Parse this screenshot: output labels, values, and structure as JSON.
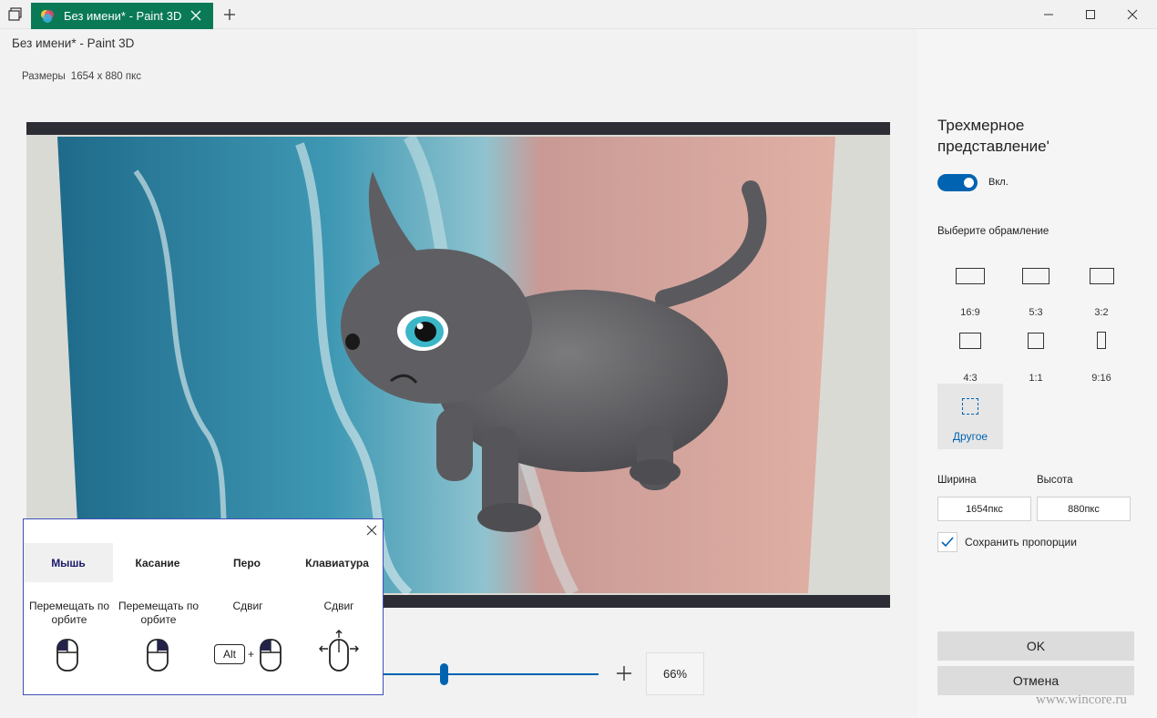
{
  "window": {
    "tab_title": "Без имени* - Paint 3D",
    "app_title": "Без имени* - Paint 3D"
  },
  "canvas_info": {
    "label": "Размеры",
    "value": "1654 x 880 пкс"
  },
  "panel": {
    "title": "Трехмерное представление'",
    "toggle": {
      "label": "Вкл.",
      "on": true
    },
    "frame_label": "Выберите обрамление",
    "ratios": [
      "16:9",
      "5:3",
      "3:2",
      "4:3",
      "1:1",
      "9:16"
    ],
    "other_label": "Другое",
    "width_label": "Ширина",
    "height_label": "Высота",
    "width_value": "1654пкс",
    "height_value": "880пкс",
    "keep_ratio_label": "Сохранить пропорции",
    "keep_ratio_checked": true,
    "ok_label": "OK",
    "cancel_label": "Отмена"
  },
  "zoom": {
    "value": "66%"
  },
  "help": {
    "tabs": [
      "Мышь",
      "Касание",
      "Перо",
      "Клавиатура"
    ],
    "active_tab": "Мышь",
    "columns": [
      {
        "label": "Перемещать по орбите"
      },
      {
        "label": "Перемещать по орбите"
      },
      {
        "label": "Сдвиг",
        "key": "Alt",
        "plus": "+"
      },
      {
        "label": "Сдвиг"
      }
    ]
  },
  "watermark": "www.wincore.ru",
  "colors": {
    "accent": "#0063b1",
    "tab": "#0a7a56"
  }
}
